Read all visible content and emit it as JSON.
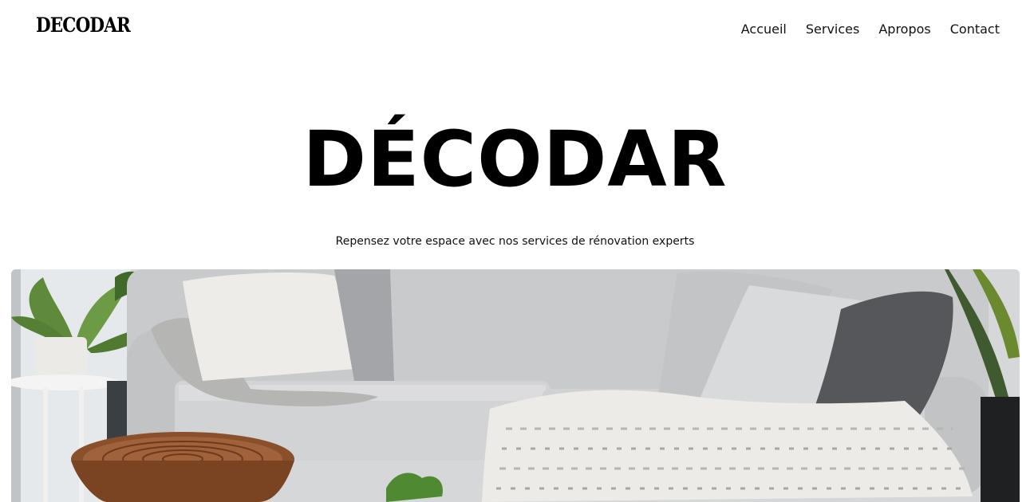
{
  "brand": {
    "logo_text": "DECODAR"
  },
  "nav": {
    "items": [
      {
        "label": "Accueil"
      },
      {
        "label": "Services"
      },
      {
        "label": "Apropos"
      },
      {
        "label": "Contact"
      }
    ]
  },
  "hero": {
    "title": "DÉCODAR",
    "subtitle": "Repensez votre espace avec nos services de rénovation experts",
    "image_subject": "living-room-sofa-photo"
  }
}
